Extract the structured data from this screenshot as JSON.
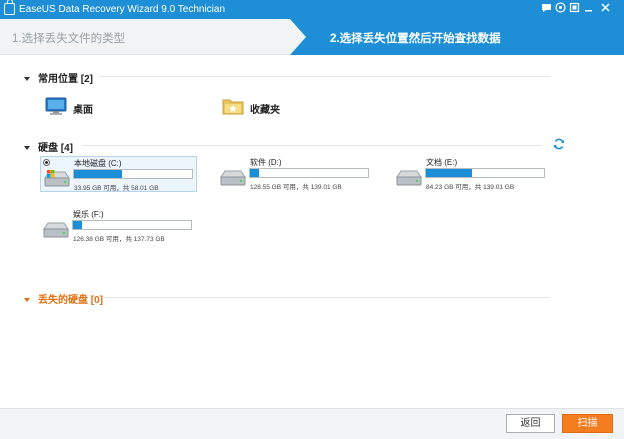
{
  "window": {
    "title": "EaseUS Data Recovery Wizard 9.0 Technician",
    "controls": [
      "message-icon",
      "help-icon",
      "restore-icon",
      "minimize-icon",
      "close-icon"
    ]
  },
  "steps": {
    "step1": "1.选择丢失文件的类型",
    "step2": "2.选择丢失位置然后开始查找数据"
  },
  "sections": {
    "common": "常用位置 [2]",
    "disks": "硬盘 [4]",
    "lost": "丢失的硬盘 [0]"
  },
  "places": [
    {
      "label": "桌面",
      "icon": "desktop-icon"
    },
    {
      "label": "收藏夹",
      "icon": "favorites-folder-icon"
    }
  ],
  "drives": [
    {
      "name": "本地磁盘 (C:)",
      "size": "33.95 GB 可用，共 58.01 GB",
      "used_fraction": 0.41,
      "selected": true
    },
    {
      "name": "软件 (D:)",
      "size": "128.55 GB 可用，共 139.01 GB",
      "used_fraction": 0.08,
      "selected": false
    },
    {
      "name": "文档 (E:)",
      "size": "84.23 GB 可用，共 139.01 GB",
      "used_fraction": 0.39,
      "selected": false
    },
    {
      "name": "娱乐 (F:)",
      "size": "126.38 GB 可用，共 137.73 GB",
      "used_fraction": 0.08,
      "selected": false
    }
  ],
  "footer": {
    "back_label": "返回",
    "scan_label": "扫描"
  },
  "colors": {
    "accent": "#1e8fd6",
    "scan_button": "#f57c1f",
    "lost_section": "#e07010"
  }
}
